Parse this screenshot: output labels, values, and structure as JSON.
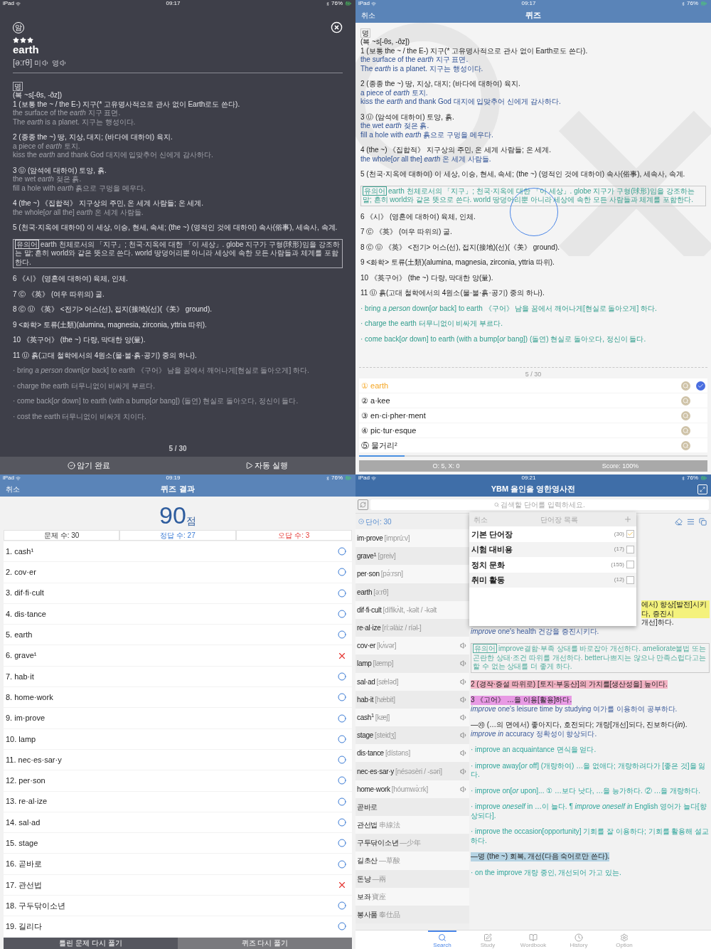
{
  "flashcard": {
    "status": {
      "carrier": "iPad",
      "time": "09:17",
      "battery": "76%"
    },
    "badge": "암",
    "stars": 3,
    "word": "earth",
    "pronunciation": "[ə:rθ]",
    "audio": [
      "미",
      "영"
    ],
    "blocks": [
      [
        {
          "kind": "pos",
          "text": "명"
        },
        {
          "kind": "def",
          "text": "(복 ~s[-θs, -ðz])"
        },
        {
          "kind": "def",
          "text": "1 (보통 the ~ / the E-) 지구(* 고유명사적으로 관사 없이 Earth로도 쓴다)."
        },
        {
          "kind": "ex",
          "text": "the surface of the *earth* 지구 표면."
        },
        {
          "kind": "ex",
          "text": "The *earth* is a planet. 지구는 행성이다."
        }
      ],
      [
        {
          "kind": "def",
          "text": "2 (종종 the ~) 땅, 지상, 대지; (바다에 대하여) 육지."
        },
        {
          "kind": "ex",
          "text": "a piece of *earth* 토지."
        },
        {
          "kind": "ex",
          "text": "kiss the *earth* and thank God 대지에 입맞추어 신에게 감사하다."
        }
      ],
      [
        {
          "kind": "def",
          "text": "3 Ⓤ (암석에 대하여) 토양, 흙."
        },
        {
          "kind": "ex",
          "text": "the wet *earth* 젖은 흙."
        },
        {
          "kind": "ex",
          "text": "fill a hole with *earth* 흙으로 구멍을 메우다."
        }
      ],
      [
        {
          "kind": "def",
          "text": "4 (the ~) 《집합적》 지구상의 주민, 온 세계 사람들; 온 세계."
        },
        {
          "kind": "ex",
          "text": "the whole[*or* all the] *earth* 온 세계 사람들."
        }
      ],
      [
        {
          "kind": "def",
          "text": "5 (천국·지옥에 대하여) 이 세상, 이승, 현세, 속세; (the ~) (영적인 것에 대하여) 속사(俗事), 세속사, 속계."
        }
      ],
      [
        {
          "kind": "note",
          "label": "유의어",
          "text": "earth 천체로서의 「지구」; 천국·지옥에 대한 「이 세상」. globe 지구가 구형(球形)임을 강조하는 말; 흔히 world와 같은 뜻으로 쓴다. world 땅덩어리뿐 아니라 세상에 속한 모든 사람들과 체계를 포함한다."
        }
      ],
      [
        {
          "kind": "def",
          "text": "6 《시》 (영혼에 대하여) 육체, 인체."
        }
      ],
      [
        {
          "kind": "def",
          "text": "7 Ⓒ 《英》 (여우 따위의) 굴."
        }
      ],
      [
        {
          "kind": "def",
          "text": "8 Ⓒ Ⓤ 《英》 <전기> 어스(선), 접지(接地)(선)(《美》 ground)."
        }
      ],
      [
        {
          "kind": "def",
          "text": "9 <화학> 토류(土類)(alumina, magnesia, zirconia, yttria 따위)."
        }
      ],
      [
        {
          "kind": "def",
          "text": "10 《英구어》 (the ~) 다량, 막대한 양(量)."
        }
      ],
      [
        {
          "kind": "def",
          "text": "11 Ⓤ 흙(고대 철학에서의 4원소(물·불·흙·공기) 중의 하나)."
        }
      ],
      [
        {
          "kind": "idiom",
          "text": "· bring *a person* down[*or* back] to earth 《구어》 남을 꿈에서 깨어나게[현실로 돌아오게] 하다."
        }
      ],
      [
        {
          "kind": "idiom",
          "text": "· charge the earth 터무니없이 비싸게 부르다."
        }
      ],
      [
        {
          "kind": "idiom",
          "text": "· come back[*or* down] to earth (with a bump[*or* bang]) (돌연) 현실로 돌아오다, 정신이 들다."
        }
      ],
      [
        {
          "kind": "idiom",
          "text": "· cost the earth 터무니없이 비싸게 치이다."
        }
      ]
    ],
    "counter": "5 / 30",
    "buttons": [
      "암기 완료",
      "자동 실행"
    ]
  },
  "quiz": {
    "status": {
      "carrier": "iPad",
      "time": "09:17",
      "battery": "76%"
    },
    "cancel": "취소",
    "title": "퀴즈",
    "blocks": [
      [
        {
          "kind": "pos",
          "text": "명"
        },
        {
          "kind": "def",
          "text": "(복 ~s[-θs, -ðz])"
        },
        {
          "kind": "def",
          "text": "1 (보통 the ~ / the E-) 지구(* 고유명사적으로 관사 없이 Earth로도 쓴다)."
        },
        {
          "kind": "ex",
          "text": "the surface of the *earth* 지구 표면."
        },
        {
          "kind": "ex",
          "text": "The *earth* is a planet. 지구는 행성이다."
        }
      ],
      [
        {
          "kind": "def",
          "text": "2 (종종 the ~) 땅, 지상, 대지; (바다에 대하여) 육지."
        },
        {
          "kind": "ex",
          "text": "a piece of *earth* 토지."
        },
        {
          "kind": "ex",
          "text": "kiss the *earth* and thank God 대지에 입맞추어 신에게 감사하다."
        }
      ],
      [
        {
          "kind": "def",
          "text": "3 Ⓤ (암석에 대하여) 토양, 흙."
        },
        {
          "kind": "ex",
          "text": "the wet *earth* 젖은 흙."
        },
        {
          "kind": "ex",
          "text": "fill a hole with *earth* 흙으로 구멍을 메우다."
        }
      ],
      [
        {
          "kind": "def",
          "text": "4 (the ~) 《집합적》 지구상의 주민, 온 세계 사람들; 온 세계."
        },
        {
          "kind": "ex",
          "text": "the whole[*or* all the] *earth* 온 세계 사람들."
        }
      ],
      [
        {
          "kind": "def",
          "text": "5 (천국·지옥에 대하여) 이 세상, 이승, 현세, 속세; (the ~) (영적인 것에 대하여) 속사(俗事), 세속사, 속계."
        }
      ],
      [
        {
          "kind": "note",
          "label": "유의어",
          "text": "earth 천체로서의 「지구」; 천국·지옥에 대한 「이 세상」. globe 지구가 구형(球形)임을 강조하는 말; 흔히 world와 같은 뜻으로 쓴다. world 땅덩어리뿐 아니라 세상에 속한 모든 사람들과 체계를 포함한다."
        }
      ],
      [
        {
          "kind": "def",
          "text": "6 《시》 (영혼에 대하여) 육체, 인체."
        }
      ],
      [
        {
          "kind": "def",
          "text": "7 Ⓒ 《英》 (여우 따위의) 굴."
        }
      ],
      [
        {
          "kind": "def",
          "text": "8 Ⓒ Ⓤ 《英》 <전기> 어스(선), 접지(接地)(선)(《美》 ground)."
        }
      ],
      [
        {
          "kind": "def",
          "text": "9 <화학> 토류(土類)(alumina, magnesia, zirconia, yttria 따위)."
        }
      ],
      [
        {
          "kind": "def",
          "text": "10 《英구어》 (the ~) 다량, 막대한 양(量)."
        }
      ],
      [
        {
          "kind": "def",
          "text": "11 Ⓤ 흙(고대 철학에서의 4원소(물·불·흙·공기) 중의 하나)."
        }
      ],
      [
        {
          "kind": "idiom",
          "text": "· bring *a person* down[*or* back] to earth 《구어》 남을 꿈에서 깨어나게[현실로 돌아오게] 하다."
        }
      ],
      [
        {
          "kind": "idiom",
          "text": "· charge the earth 터무니없이 비싸게 부르다."
        }
      ],
      [
        {
          "kind": "idiom",
          "text": "· come back[*or* down] to earth (with a bump[*or* bang]) (돌연) 현실로 돌아오다, 정신이 들다."
        }
      ]
    ],
    "counter": "5 / 30",
    "options": [
      {
        "number": "①",
        "text": "earth",
        "selected": true
      },
      {
        "number": "②",
        "text": "a·kee",
        "selected": false
      },
      {
        "number": "③",
        "text": "en·ci·pher·ment",
        "selected": false
      },
      {
        "number": "④",
        "text": "pic·tur·esque",
        "selected": false
      },
      {
        "number": "⑤",
        "text": "물거리²",
        "selected": false
      }
    ],
    "progress": {
      "level": 0.13
    },
    "footer": [
      "O: 5, X: 0",
      "Score: 100%"
    ]
  },
  "results": {
    "status": {
      "carrier": "iPad",
      "time": "09:19",
      "battery": "76%"
    },
    "cancel": "취소",
    "title": "퀴즈 결과",
    "score": "90",
    "score_unit": "점",
    "stats": [
      {
        "kind": "total",
        "text": "문제 수: 30"
      },
      {
        "kind": "correct",
        "text": "정답 수: 27"
      },
      {
        "kind": "wrong",
        "text": "오답 수: 3"
      }
    ],
    "rows": [
      {
        "text": "1. cash¹",
        "correct": true
      },
      {
        "text": "2. cov·er",
        "correct": true
      },
      {
        "text": "3. dif·fi·cult",
        "correct": true
      },
      {
        "text": "4. dis·tance",
        "correct": true
      },
      {
        "text": "5. earth",
        "correct": true
      },
      {
        "text": "6. grave¹",
        "correct": false
      },
      {
        "text": "7. hab·it",
        "correct": true
      },
      {
        "text": "8. home·work",
        "correct": true
      },
      {
        "text": "9. im·prove",
        "correct": true
      },
      {
        "text": "10. lamp",
        "correct": true
      },
      {
        "text": "11. nec·es·sar·y",
        "correct": true
      },
      {
        "text": "12. per·son",
        "correct": true
      },
      {
        "text": "13. re·al·ize",
        "correct": true
      },
      {
        "text": "14. sal·ad",
        "correct": true
      },
      {
        "text": "15. stage",
        "correct": true
      },
      {
        "text": "16. 곧바로",
        "correct": true
      },
      {
        "text": "17. 관선법",
        "correct": false
      },
      {
        "text": "18. 구두닦이소년",
        "correct": true
      },
      {
        "text": "19. 길리다",
        "correct": true
      }
    ],
    "buttons": [
      "틀린 문제 다시 풀기",
      "퀴즈 다시 풀기"
    ]
  },
  "dictionary": {
    "status": {
      "carrier": "iPad",
      "time": "09:21",
      "battery": "76%"
    },
    "title": "YBM 올인올 영한영사전",
    "search": {
      "placeholder": "검색할 단어를 입력하세요."
    },
    "word_count": "단어: 30",
    "words": [
      {
        "word": "im·prove",
        "pron": "[imprú:v]",
        "speaker": false
      },
      {
        "word": "grave$^{1}$",
        "pron": "[greiv]",
        "speaker": false
      },
      {
        "word": "per·son",
        "pron": "[pə́:rsn]",
        "speaker": false
      },
      {
        "word": "earth",
        "pron": "[ə:rθ]",
        "speaker": false
      },
      {
        "word": "dif·fi·cult",
        "pron": "[dífikʌ̀lt, -kəlt / -kəlt",
        "speaker": false
      },
      {
        "word": "re·al·ize",
        "pron": "[rí:əlàiz / ríəl-]",
        "speaker": false
      },
      {
        "word": "cov·er",
        "pron": "[kʌ́vər]",
        "speaker": true
      },
      {
        "word": "lamp",
        "pron": "[læmp]",
        "speaker": true
      },
      {
        "word": "sal·ad",
        "pron": "[sǽləd]",
        "speaker": true
      },
      {
        "word": "hab·it",
        "pron": "[hǽbit]",
        "speaker": true
      },
      {
        "word": "cash$^{1}$",
        "pron": "[kæʃ]",
        "speaker": true
      },
      {
        "word": "stage",
        "pron": "[steidʒ]",
        "speaker": true
      },
      {
        "word": "dis·tance",
        "pron": "[dístəns]",
        "speaker": true
      },
      {
        "word": "nec·es·sar·y",
        "pron": "[nésəsèri / -səri]",
        "speaker": true
      },
      {
        "word": "home·work",
        "pron": "[hóumwə̀:rk]",
        "speaker": true
      },
      {
        "word": "곧바로",
        "speaker": false
      },
      {
        "word": "관선법",
        "pron": "串線法",
        "speaker": false
      },
      {
        "word": "구두닦이소년",
        "pron": "—少年",
        "speaker": false
      },
      {
        "word": "길초산",
        "pron": "—草酸",
        "speaker": false
      },
      {
        "word": "돈냥",
        "pron": "—兩",
        "speaker": false
      },
      {
        "word": "보좌",
        "pron": "寶座",
        "speaker": false
      },
      {
        "word": "봉사품",
        "pron": "奉仕品",
        "speaker": false
      }
    ],
    "wordbook_popup": {
      "cancel": "취소",
      "title": "단어장 목록",
      "lists": [
        {
          "name": "기본 단어장",
          "count": "(30)",
          "checked": true
        },
        {
          "name": "시험 대비용",
          "count": "(17)",
          "checked": false
        },
        {
          "name": "정치 문화",
          "count": "(155)",
          "checked": false
        },
        {
          "name": "취미 활동",
          "count": "(12)",
          "checked": false
        }
      ]
    },
    "detail_blocks": [
      [
        {
          "kind": "partial",
          "text": "에서) 향상[발전]시키다, 증진시",
          "color": "#f4f27c"
        },
        {
          "kind": "partial",
          "text": "개선]하다."
        },
        {
          "kind": "ex",
          "text": "*improve* one's health 건강을 증진시키다."
        }
      ],
      [
        {
          "kind": "note",
          "label": "유의어",
          "text": "improve결함·부족 상태를 바로잡아 개선하다. ameliorate불법 또는 곤란한 상태·조건 따위를 개선하다. better나쁘지는 않으나 만족스럽다고는 할 수 없는 상태를 더 좋게 하다."
        }
      ],
      [
        {
          "kind": "def",
          "text": "2 (경작·증설 따위로) [토지·부동산]의 가치를[생산성을] 높이다.",
          "color": "#f3b3c4"
        }
      ],
      [
        {
          "kind": "def",
          "text": "3 《고어》 …을 이용[활용]하다.",
          "color": "#e89ae4"
        },
        {
          "kind": "ex",
          "text": "*improve* one's leisure time by studying 여가를 이용하여 공부하다."
        }
      ],
      [
        {
          "kind": "def",
          "text": "—㉶ (…의 면에서) 좋아지다, 호전되다; 개량[개선]되다, 진보하다(*in*)."
        },
        {
          "kind": "ex",
          "text": "*improve in* accuracy 정확성이 향상되다."
        }
      ],
      [
        {
          "kind": "idiom",
          "text": "· improve an acquaintance 면식을 얻다."
        }
      ],
      [
        {
          "kind": "idiom",
          "text": "· improve away[*or* off] (개량하여) …을 없애다; 개량하려다가 [좋은 것]을 잃다."
        }
      ],
      [
        {
          "kind": "idiom",
          "text": "· improve on[*or* upon]... ① …보다 낫다, …을 능가하다. ② …을 개량하다."
        }
      ],
      [
        {
          "kind": "idiom",
          "text": "· improve *oneself* in …이 늘다. ¶ *improve oneself in* English 영어가 늘다[향상되다]."
        }
      ],
      [
        {
          "kind": "idiom",
          "text": "· improve the occasion[opportunity] 기회를 잘 이용하다; 기회를 활용해 설교하다."
        }
      ],
      [
        {
          "kind": "def",
          "text": "—명 (the ~) 회복, 개선(다음 숙어로만 쓴다).",
          "color": "#b5d3e3"
        }
      ],
      [
        {
          "kind": "idiom",
          "text": "· on the improve 개량 중인, 개선되어 가고 있는."
        }
      ]
    ],
    "tabs": [
      {
        "label": "Search",
        "selected": true
      },
      {
        "label": "Study",
        "selected": false
      },
      {
        "label": "Wordbook",
        "selected": false
      },
      {
        "label": "History",
        "selected": false
      },
      {
        "label": "Option",
        "selected": false
      }
    ]
  }
}
